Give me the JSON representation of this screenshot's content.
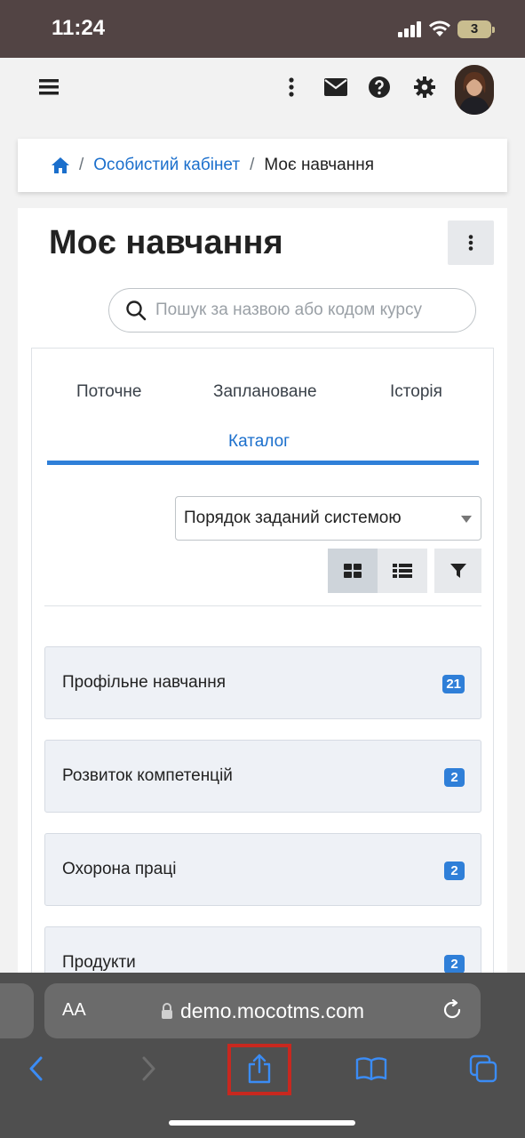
{
  "status_bar": {
    "time": "11:24",
    "battery": "3"
  },
  "navbar": {
    "menu_icon": "hamburger-icon",
    "more_icon": "vertical-dots-icon",
    "messages_icon": "envelope-icon",
    "help_icon": "question-circle-icon",
    "settings_icon": "gear-icon",
    "avatar": "user-avatar"
  },
  "breadcrumb": {
    "home_icon": "home-icon",
    "items": [
      "Особистий кабінет",
      "Моє навчання"
    ]
  },
  "page": {
    "title": "Моє навчання",
    "search_placeholder": "Пошук за назвою або кодом курсу"
  },
  "tabs": [
    "Поточне",
    "Заплановане",
    "Історія",
    "Каталог"
  ],
  "active_tab": "Каталог",
  "sort": {
    "selected": "Порядок заданий системою"
  },
  "view_buttons": [
    "grid-view-icon",
    "list-view-icon",
    "filter-icon"
  ],
  "categories": [
    {
      "name": "Профільне навчання",
      "count": "21"
    },
    {
      "name": "Розвиток компетенцій",
      "count": "2"
    },
    {
      "name": "Охорона праці",
      "count": "2"
    },
    {
      "name": "Продукти",
      "count": "2"
    }
  ],
  "safari": {
    "aa_label": "AA",
    "url": "demo.mocotms.com",
    "toolbar": [
      "back-icon",
      "forward-icon",
      "share-icon",
      "bookmarks-icon",
      "tabs-icon"
    ]
  },
  "colors": {
    "accent": "#1b6fcc",
    "status_bar": "#524444",
    "safari_bar": "#4f4f4f",
    "highlight": "#c8281f"
  }
}
